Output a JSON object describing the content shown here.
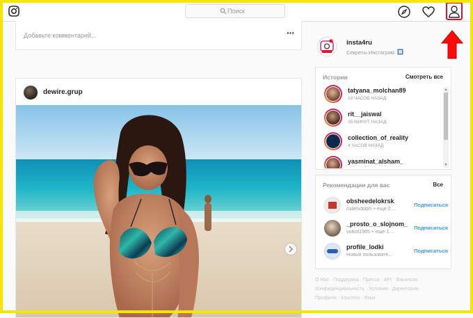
{
  "header": {
    "search_placeholder": "Поиск"
  },
  "comment": {
    "placeholder": "Добавьте комментарий...",
    "more": "···"
  },
  "post": {
    "username": "dewire.grup"
  },
  "me": {
    "username": "insta4ru",
    "subtitle": "Секреты Инстаграм"
  },
  "stories": {
    "title": "Истории",
    "see_all": "Смотреть все",
    "items": [
      {
        "name": "tatyana_molchan89",
        "time": "19 ЧАСОВ НАЗАД"
      },
      {
        "name": "rit__jaiswal",
        "time": "35 МИНУТ НАЗАД"
      },
      {
        "name": "collection_of_reality",
        "time": "4 ЧАСОВ НАЗАД"
      },
      {
        "name": "yasminat_alsham_",
        "time": ""
      }
    ]
  },
  "recommendations": {
    "title": "Рекомендации для вас",
    "all": "Все",
    "items": [
      {
        "name": "obsheedelokrsk",
        "sub": "rudelsdolph + еще 2 ...",
        "action": "Подписаться"
      },
      {
        "name": "_prosto_o_slojnom_",
        "sub": "volkof1985 + еще 1 ...",
        "action": "Подписаться"
      },
      {
        "name": "profile_lodki",
        "sub": "Новый пользовате...",
        "action": "Подписаться"
      }
    ]
  },
  "footer": {
    "links": [
      "О Нас",
      "Поддержка",
      "Пресса",
      "API",
      "Вакансии",
      "Конфиденциальность",
      "Условия",
      "Директория",
      "Профили",
      "Хэштеги",
      "Язык"
    ]
  }
}
